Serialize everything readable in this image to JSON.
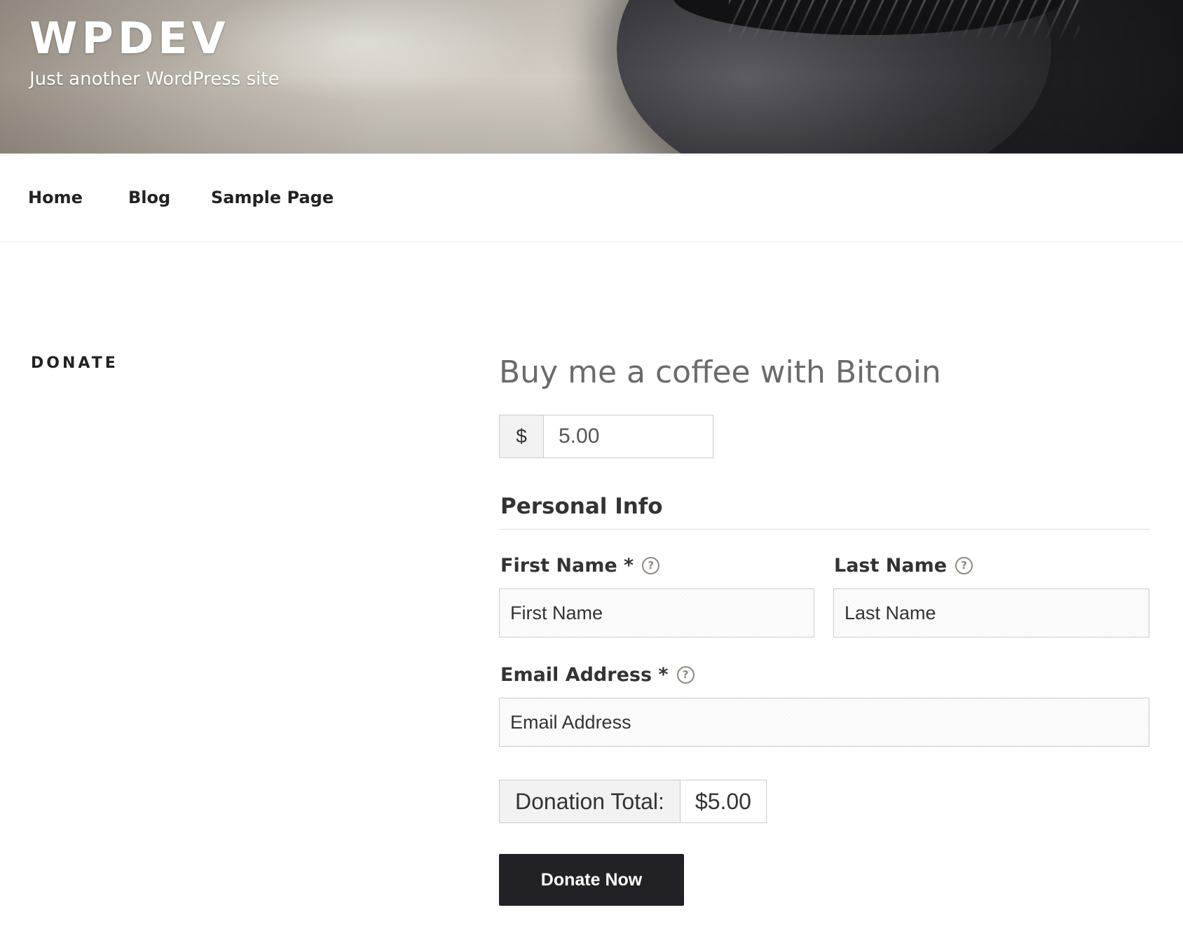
{
  "site": {
    "title": "WPDEV",
    "tagline": "Just another WordPress site"
  },
  "nav": {
    "items": [
      {
        "label": "Home"
      },
      {
        "label": "Blog"
      },
      {
        "label": "Sample Page"
      }
    ]
  },
  "page": {
    "heading": "DONATE"
  },
  "form": {
    "title": "Buy me a coffee with Bitcoin",
    "currency_symbol": "$",
    "amount": "5.00",
    "personal_info_title": "Personal Info",
    "first_name": {
      "label": "First Name *",
      "placeholder": "First Name",
      "help_icon": "question-circle-icon"
    },
    "last_name": {
      "label": "Last Name",
      "placeholder": "Last Name",
      "help_icon": "question-circle-icon"
    },
    "email": {
      "label": "Email Address *",
      "placeholder": "Email Address",
      "help_icon": "question-circle-icon"
    },
    "total_label": "Donation Total:",
    "total_amount": "$5.00",
    "submit_label": "Donate Now"
  },
  "colors": {
    "button_bg": "#222226",
    "input_border": "#cccccc",
    "addon_bg": "#f2f2f2",
    "title_gray": "#6b6b6b"
  }
}
